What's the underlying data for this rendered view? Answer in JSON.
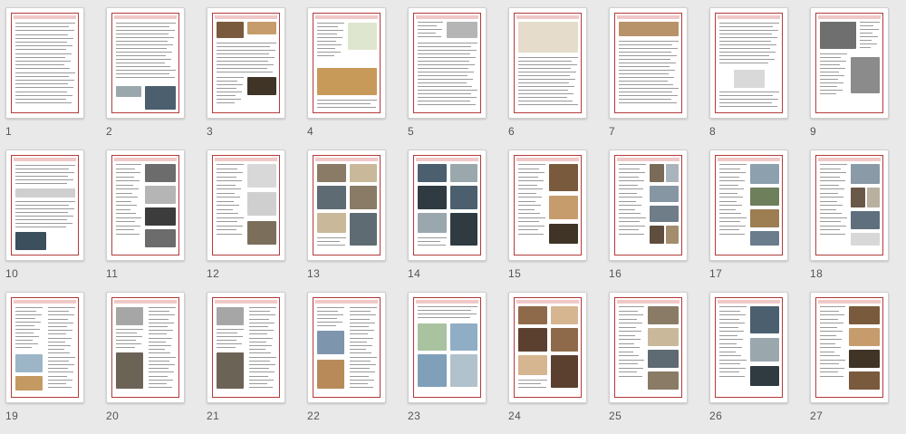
{
  "window": {
    "background": "#e9e9e9"
  },
  "pages": [
    {
      "number": "1",
      "layout": "text"
    },
    {
      "number": "2",
      "layout": "text-image-bottom"
    },
    {
      "number": "3",
      "layout": "mixed-images"
    },
    {
      "number": "4",
      "layout": "diagram-image"
    },
    {
      "number": "5",
      "layout": "photo-top-text"
    },
    {
      "number": "6",
      "layout": "figure-top"
    },
    {
      "number": "7",
      "layout": "ship-drawing-text"
    },
    {
      "number": "8",
      "layout": "text-small-figure"
    },
    {
      "number": "9",
      "layout": "ship-photo-text"
    },
    {
      "number": "10",
      "layout": "text-figure"
    },
    {
      "number": "11",
      "layout": "photo-grid"
    },
    {
      "number": "12",
      "layout": "diagrams"
    },
    {
      "number": "13",
      "layout": "photo-grid-dense"
    },
    {
      "number": "14",
      "layout": "photo-grid-dense"
    },
    {
      "number": "15",
      "layout": "text-photos"
    },
    {
      "number": "16",
      "layout": "portraits"
    },
    {
      "number": "17",
      "layout": "paintings"
    },
    {
      "number": "18",
      "layout": "portraits-ships"
    },
    {
      "number": "19",
      "layout": "table-map"
    },
    {
      "number": "20",
      "layout": "table-images"
    },
    {
      "number": "21",
      "layout": "table-images"
    },
    {
      "number": "22",
      "layout": "table-photos"
    },
    {
      "number": "23",
      "layout": "maps-photos"
    },
    {
      "number": "24",
      "layout": "photo-grid-dense"
    },
    {
      "number": "25",
      "layout": "photo-grid"
    },
    {
      "number": "26",
      "layout": "text-photos"
    },
    {
      "number": "27",
      "layout": "photo-grid"
    }
  ]
}
